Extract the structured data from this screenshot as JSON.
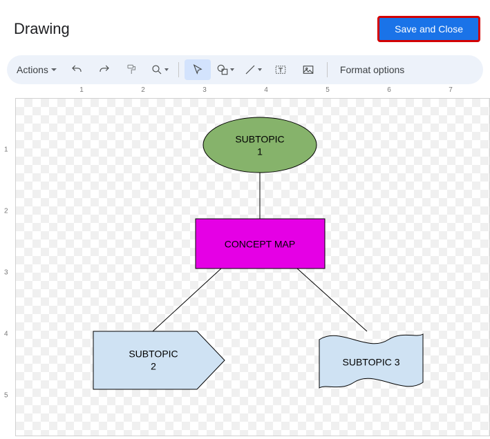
{
  "dialog": {
    "title": "Drawing",
    "save_button": "Save and Close"
  },
  "toolbar": {
    "actions_label": "Actions",
    "format_options_label": "Format options"
  },
  "ruler": {
    "h": [
      "1",
      "2",
      "3",
      "4",
      "5",
      "6",
      "7"
    ],
    "v": [
      "1",
      "2",
      "3",
      "4",
      "5"
    ]
  },
  "shapes": {
    "subtopic1_line1": "SUBTOPIC",
    "subtopic1_line2": "1",
    "concept_map": "CONCEPT MAP",
    "subtopic2_line1": "SUBTOPIC",
    "subtopic2_line2": "2",
    "subtopic3": "SUBTOPIC 3"
  }
}
